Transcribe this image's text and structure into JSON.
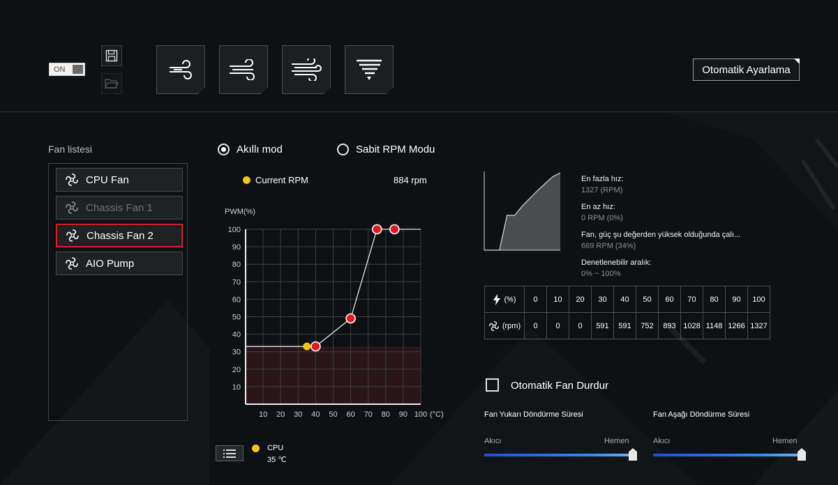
{
  "toolbar": {
    "toggle_label": "ON",
    "auto_tune_label": "Otomatik Ayarlama"
  },
  "fan_list": {
    "title": "Fan listesi",
    "items": [
      {
        "label": "CPU Fan",
        "state": "normal"
      },
      {
        "label": "Chassis Fan 1",
        "state": "disabled"
      },
      {
        "label": "Chassis Fan 2",
        "state": "selected"
      },
      {
        "label": "AIO Pump",
        "state": "normal"
      }
    ]
  },
  "modes": {
    "smart": "Akıllı mod",
    "fixed": "Sabit RPM Modu",
    "selected": "smart"
  },
  "current": {
    "label": "Current RPM",
    "value": "884 rpm"
  },
  "chart_data": {
    "type": "line",
    "ylabel": "PWM(%)",
    "xlabel": "(°C)",
    "xlim": [
      0,
      100
    ],
    "ylim": [
      0,
      100
    ],
    "x_ticks": [
      10,
      20,
      30,
      40,
      50,
      60,
      70,
      80,
      90,
      100
    ],
    "y_ticks": [
      10,
      20,
      30,
      40,
      50,
      60,
      70,
      80,
      90,
      100
    ],
    "curve_points": [
      [
        40,
        33
      ],
      [
        60,
        49
      ],
      [
        75,
        100
      ],
      [
        85,
        100
      ]
    ],
    "flat_start": 33,
    "min_threshold": 33,
    "current_point": [
      35,
      33
    ],
    "grid": true
  },
  "sensor": {
    "name": "CPU",
    "value": "35 ℃"
  },
  "info": {
    "max_label": "En fazla hız:",
    "max_value": "1327 (RPM)",
    "min_label": "En az hız:",
    "min_value": "0 RPM (0%)",
    "start_label": "Fan, güç şu değerden yüksek olduğunda çalı...",
    "start_value": "669 RPM (34%)",
    "range_label": "Denetlenebilir aralık:",
    "range_value": "0% ~ 100%"
  },
  "rpm_table": {
    "pwm_header": "(%)",
    "rpm_header": "(rpm)",
    "pwm": [
      "0",
      "10",
      "20",
      "30",
      "40",
      "50",
      "60",
      "70",
      "80",
      "90",
      "100"
    ],
    "rpm": [
      "0",
      "0",
      "0",
      "591",
      "591",
      "752",
      "893",
      "1028",
      "1148",
      "1266",
      "1327"
    ]
  },
  "mini_curve": {
    "rpm_pct": [
      0,
      0,
      0,
      45,
      45,
      57,
      67,
      77,
      86,
      95,
      100
    ]
  },
  "auto_stop": {
    "label": "Otomatik Fan Durdur"
  },
  "spin_up": {
    "title": "Fan Yukarı Döndürme Süresi",
    "left": "Akıcı",
    "right": "Hemen",
    "value_pct": 100
  },
  "spin_down": {
    "title": "Fan Aşağı Döndürme Süresi",
    "left": "Akıcı",
    "right": "Hemen",
    "value_pct": 100
  },
  "colors": {
    "accent_red": "#e01a22",
    "current_point": "#f5c518",
    "slider_blue": "#2a8cff"
  },
  "icons": {
    "mode_buttons": [
      "fan-silent-icon",
      "fan-standard-icon",
      "fan-turbo-icon",
      "fan-full-speed-icon"
    ],
    "save": "save-icon",
    "open": "folder-open-icon",
    "fan": "fan-icon",
    "power": "lightning-icon",
    "list": "list-icon"
  }
}
